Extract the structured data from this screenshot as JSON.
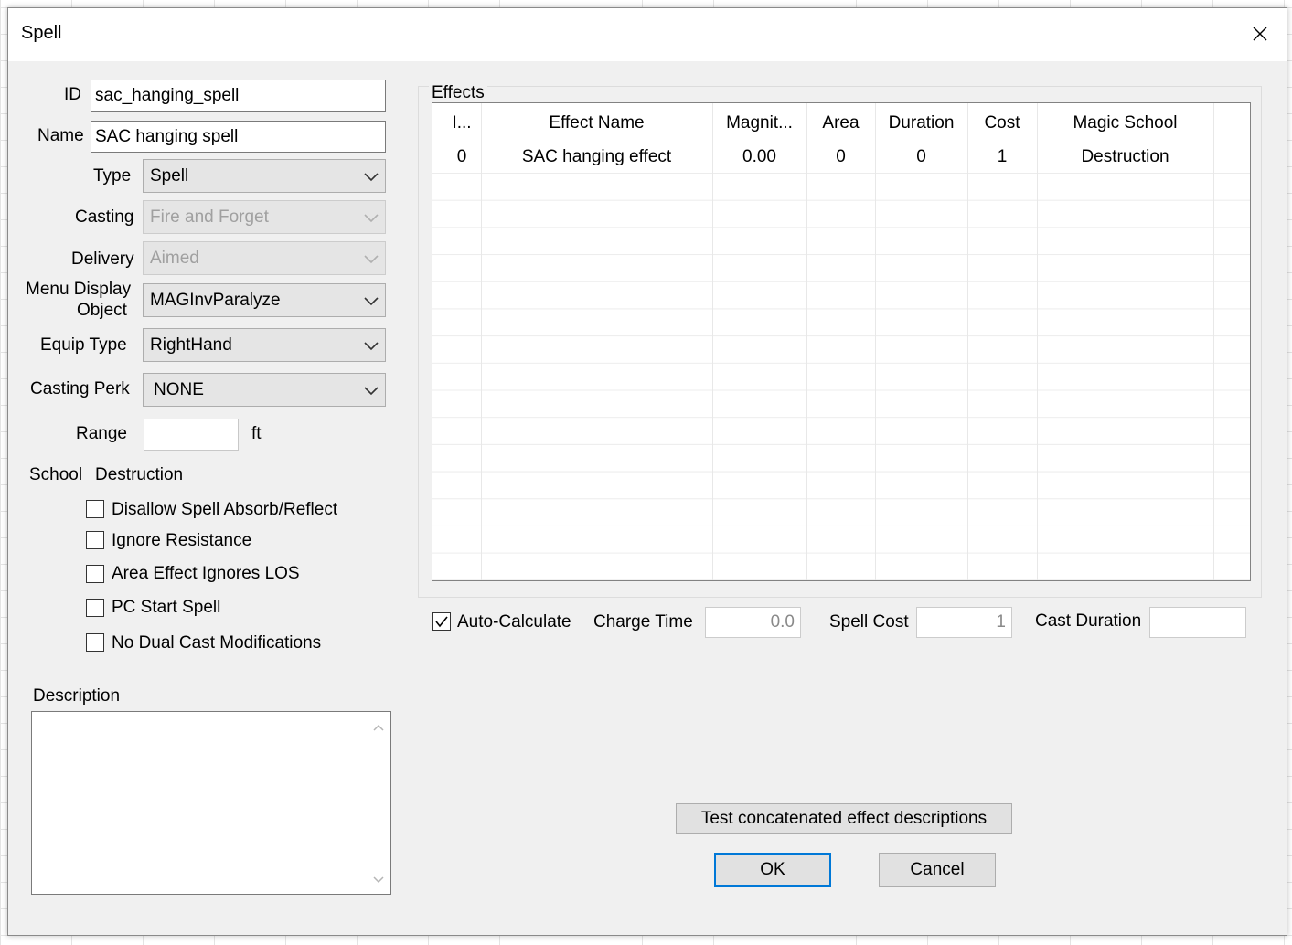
{
  "window": {
    "title": "Spell",
    "close_glyph": "✕"
  },
  "form": {
    "id_label": "ID",
    "id_value": "sac_hanging_spell",
    "name_label": "Name",
    "name_value": "SAC hanging spell",
    "type_label": "Type",
    "type_value": "Spell",
    "casting_label": "Casting",
    "casting_value": "Fire and Forget",
    "delivery_label": "Delivery",
    "delivery_value": "Aimed",
    "menu_display_label_1": "Menu Display",
    "menu_display_label_2": "Object",
    "menu_display_value": "MAGInvParalyze",
    "equip_type_label": "Equip Type",
    "equip_type_value": "RightHand",
    "casting_perk_label": "Casting Perk",
    "casting_perk_value": "NONE",
    "range_label": "Range",
    "range_value": "",
    "range_unit": "ft",
    "school_label": "School",
    "school_value": "Destruction"
  },
  "flags": [
    {
      "label": "Disallow Spell Absorb/Reflect",
      "checked": false
    },
    {
      "label": "Ignore Resistance",
      "checked": false
    },
    {
      "label": "Area Effect Ignores LOS",
      "checked": false
    },
    {
      "label": "PC Start Spell",
      "checked": false
    },
    {
      "label": "No Dual Cast Modifications",
      "checked": false
    }
  ],
  "description": {
    "label": "Description",
    "value": ""
  },
  "effects": {
    "group_title": "Effects",
    "columns": [
      "I...",
      "Effect Name",
      "Magnit...",
      "Area",
      "Duration",
      "Cost",
      "Magic School"
    ],
    "rows": [
      {
        "index": "0",
        "name": "SAC hanging effect",
        "magnitude": "0.00",
        "area": "0",
        "duration": "0",
        "cost": "1",
        "school": "Destruction"
      }
    ]
  },
  "calc": {
    "auto_label": "Auto-Calculate",
    "auto_checked": true,
    "charge_time_label": "Charge Time",
    "charge_time_value": "0.0",
    "spell_cost_label": "Spell Cost",
    "spell_cost_value": "1",
    "cast_duration_label": "Cast Duration",
    "cast_duration_value": ""
  },
  "buttons": {
    "test_label": "Test concatenated effect descriptions",
    "ok_label": "OK",
    "cancel_label": "Cancel"
  }
}
